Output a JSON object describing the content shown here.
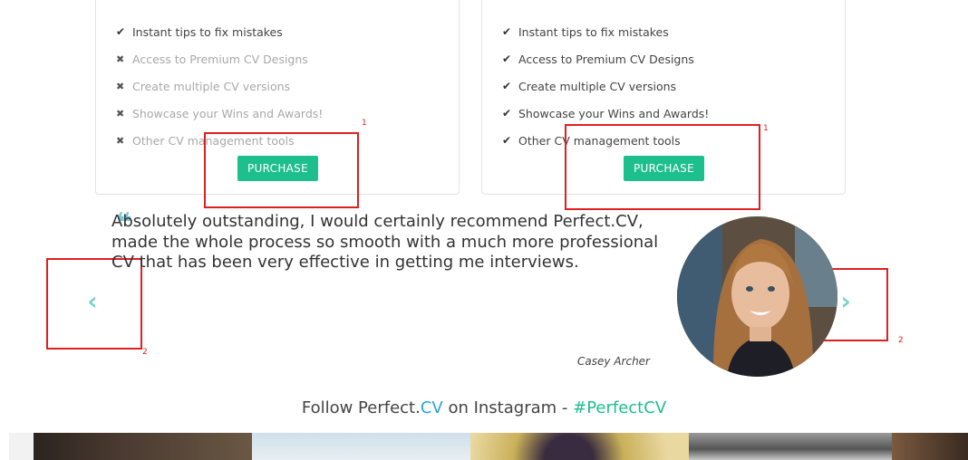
{
  "pricing": {
    "left": {
      "features": [
        {
          "text": "Instant tips to fix mistakes",
          "included": true
        },
        {
          "text": "Access to Premium CV Designs",
          "included": false
        },
        {
          "text": "Create multiple CV versions",
          "included": false
        },
        {
          "text": "Showcase your Wins and Awards!",
          "included": false
        },
        {
          "text": "Other CV management tools",
          "included": false
        }
      ],
      "button_label": "PURCHASE"
    },
    "right": {
      "features": [
        {
          "text": "Instant tips to fix mistakes",
          "included": true
        },
        {
          "text": "Access to Premium CV Designs",
          "included": true
        },
        {
          "text": "Create multiple CV versions",
          "included": true
        },
        {
          "text": "Showcase your Wins and Awards!",
          "included": true
        },
        {
          "text": "Other CV management tools",
          "included": true
        }
      ],
      "button_label": "PURCHASE"
    }
  },
  "annotations": {
    "purchase_left": "1",
    "purchase_right": "1",
    "prev_arrow": "2",
    "next_arrow": "2"
  },
  "testimonial": {
    "quote": "Absolutely outstanding, I would certainly recommend Perfect.CV, made the whole process so smooth with a much more professional CV that has been very effective in getting me interviews.",
    "author": "Casey Archer",
    "prev_icon": "chevron-left-icon",
    "next_icon": "chevron-right-icon"
  },
  "instagram": {
    "prefix": "Follow Perfect.",
    "brand": "CV",
    "middle": " on Instagram - ",
    "hashtag": "#PerfectCV"
  },
  "colors": {
    "accent_green": "#1dbf8c",
    "accent_blue": "#2aa3d6",
    "annotation_red": "#e02020",
    "arrow_teal": "#7cd3c7"
  }
}
